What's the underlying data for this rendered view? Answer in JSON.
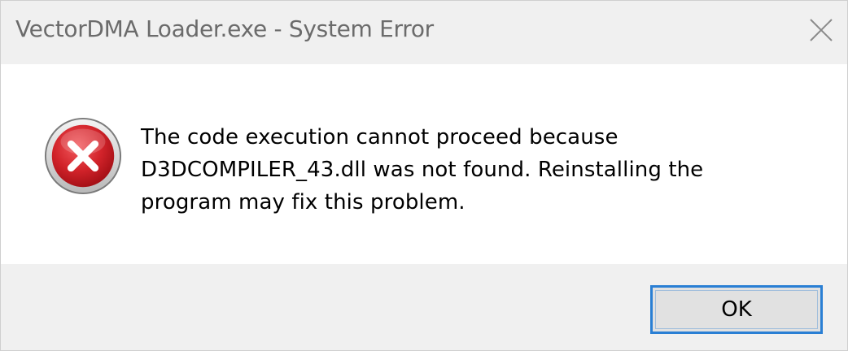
{
  "window": {
    "title": "VectorDMA Loader.exe - System Error",
    "close_icon": "close-icon"
  },
  "dialog": {
    "icon": "error-icon",
    "message_lines": [
      "The code execution cannot proceed because",
      "D3DCOMPILER_43.dll was not found. Reinstalling the",
      "program may fix this problem."
    ]
  },
  "buttons": {
    "ok_label": "OK"
  },
  "colors": {
    "titlebar_bg": "#f0f0f0",
    "footer_bg": "#f0f0f0",
    "accent": "#2a7fd4",
    "error_red": "#c8151b"
  }
}
